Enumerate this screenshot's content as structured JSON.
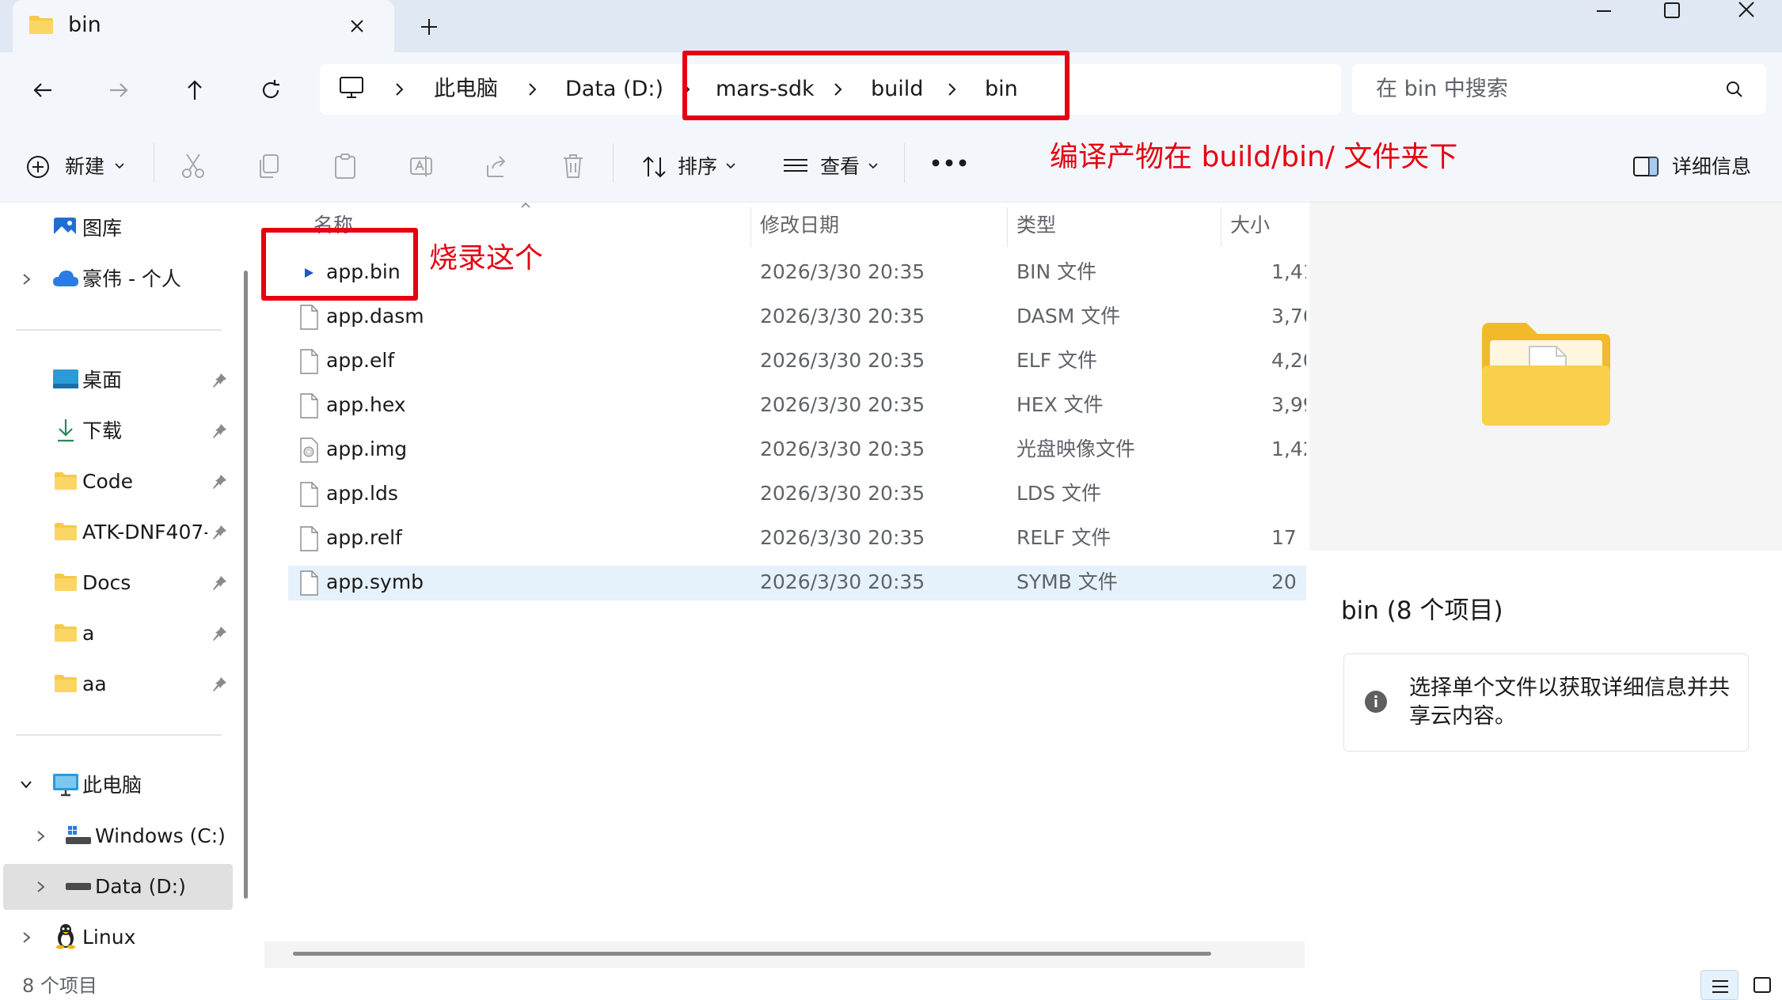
{
  "window": {
    "tab_title": "bin",
    "controls": [
      "minimize",
      "maximize",
      "close"
    ]
  },
  "nav": {
    "breadcrumb": [
      "此电脑",
      "Data (D:)",
      "mars-sdk",
      "build",
      "bin"
    ],
    "search_placeholder": "在 bin 中搜索"
  },
  "toolbar": {
    "new_label": "新建",
    "sort_label": "排序",
    "view_label": "查看",
    "more_label": "•••",
    "details_label": "详细信息"
  },
  "annotations": {
    "top": "编译产物在 build/bin/ 文件夹下",
    "burn": "烧录这个"
  },
  "sidebar": {
    "top_items": [
      {
        "label": "图库"
      },
      {
        "label": "豪伟 - 个人"
      }
    ],
    "quick_access": [
      {
        "label": "桌面",
        "pinned": true
      },
      {
        "label": "下载",
        "pinned": true
      },
      {
        "label": "Code",
        "pinned": true
      },
      {
        "label": "ATK-DNF407-",
        "pinned": true
      },
      {
        "label": "Docs",
        "pinned": true
      },
      {
        "label": "a",
        "pinned": true
      },
      {
        "label": "aa",
        "pinned": true
      }
    ],
    "this_pc": "此电脑",
    "drives": [
      {
        "label": "Windows (C:)"
      },
      {
        "label": "Data (D:)",
        "selected": true
      }
    ],
    "linux": "Linux"
  },
  "columns": [
    "名称",
    "修改日期",
    "类型",
    "大小"
  ],
  "files": [
    {
      "name": "app.bin",
      "date": "2026/3/30 20:35",
      "type": "BIN 文件",
      "size": "1,41"
    },
    {
      "name": "app.dasm",
      "date": "2026/3/30 20:35",
      "type": "DASM 文件",
      "size": "3,76"
    },
    {
      "name": "app.elf",
      "date": "2026/3/30 20:35",
      "type": "ELF 文件",
      "size": "4,20"
    },
    {
      "name": "app.hex",
      "date": "2026/3/30 20:35",
      "type": "HEX 文件",
      "size": "3,99"
    },
    {
      "name": "app.img",
      "date": "2026/3/30 20:35",
      "type": "光盘映像文件",
      "size": "1,42"
    },
    {
      "name": "app.lds",
      "date": "2026/3/30 20:35",
      "type": "LDS 文件",
      "size": ""
    },
    {
      "name": "app.relf",
      "date": "2026/3/30 20:35",
      "type": "RELF 文件",
      "size": "17"
    },
    {
      "name": "app.symb",
      "date": "2026/3/30 20:35",
      "type": "SYMB 文件",
      "size": "20"
    }
  ],
  "details_pane": {
    "title": "bin (8 个项目)",
    "message": "选择单个文件以获取详细信息并共享云内容。"
  },
  "status": {
    "item_count": "8 个项目"
  },
  "colors": {
    "annotation_red": "#e60012",
    "folder_yellow": "#f7c948",
    "selected_row": "#e5f1fb"
  }
}
